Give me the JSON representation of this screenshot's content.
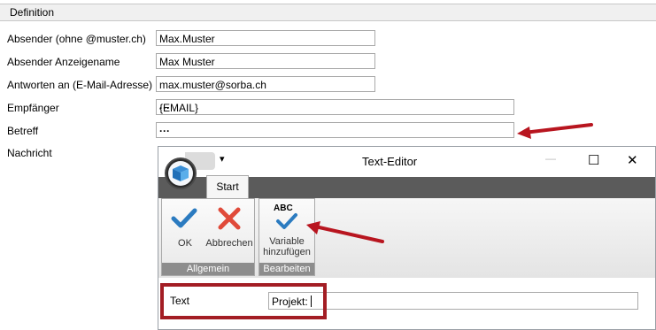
{
  "section": {
    "title": "Definition"
  },
  "form": {
    "sender_label": "Absender (ohne @muster.ch)",
    "sender_value": "Max.Muster",
    "display_label": "Absender Anzeigename",
    "display_value": "Max Muster",
    "reply_label": "Antworten an (E-Mail-Adresse)",
    "reply_value": "max.muster@sorba.ch",
    "recipient_label": "Empfänger",
    "recipient_value": "{EMAIL}",
    "subject_label": "Betreff",
    "subject_value": "",
    "message_label": "Nachricht",
    "ellipsis": "···"
  },
  "editor": {
    "title": "Text-Editor",
    "qat_dropdown": "▾",
    "minimize": "—",
    "maximize": "☐",
    "close": "✕",
    "tab_start": "Start",
    "ok_label": "OK",
    "cancel_label": "Abbrechen",
    "group_general": "Allgemein",
    "abc_text": "ABC",
    "add_var_line1": "Variable",
    "add_var_line2": "hinzufügen",
    "group_edit": "Bearbeiten",
    "text_label": "Text",
    "text_value": "Projekt: "
  },
  "colors": {
    "highlight_box": "#a31d24",
    "arrow": "#b8151f",
    "check_blue": "#2b7bc0",
    "cancel_red": "#e04a3a"
  }
}
